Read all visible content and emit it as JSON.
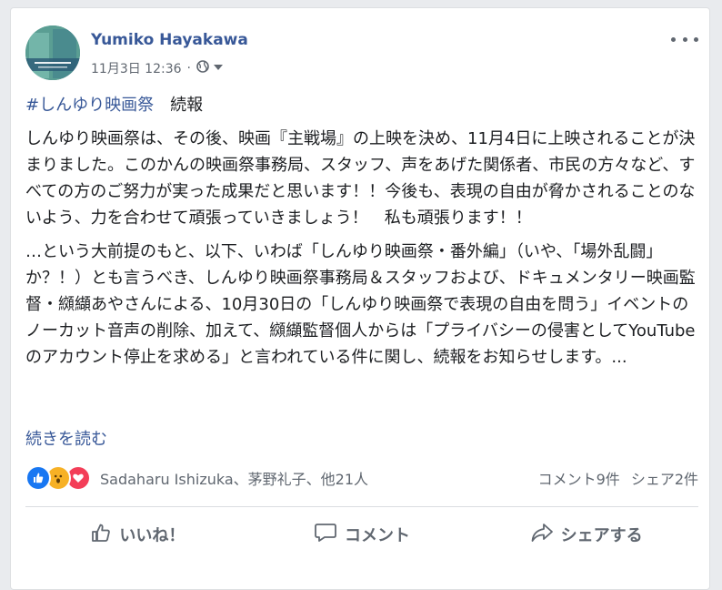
{
  "post": {
    "author": "Yumiko Hayakawa",
    "timestamp": "11月3日 12:36",
    "meta_separator": "·",
    "privacy_icon": "globe-icon",
    "options_icon": "more-options-icon",
    "hashtag": "#しんゆり映画祭",
    "heading_rest": "　続報",
    "paragraph1": "しんゆり映画祭は、その後、映画『主戦場』の上映を決め、11月4日に上映されることが決まりました。このかんの映画祭事務局、スタッフ、声をあげた関係者、市民の方々など、すべての方のご努力が実った成果だと思います！！今後も、表現の自由が脅かされることのないよう、力を合わせて頑張っていきましょう！　私も頑張ります！！",
    "paragraph2": "…という大前提のもと、以下、いわば「しんゆり映画祭・番外編」（いや、「場外乱闘」か？！）とも言うべき、しんゆり映画祭事務局＆スタッフおよび、ドキュメンタリー映画監督・纐纈あやさんによる、10月30日の「しんゆり映画祭で表現の自由を問う」イベントのノーカット音声の削除、加えて、纐纈監督個人からは「プライバシーの侵害としてYouTubeのアカウント停止を求める」と言われている件に関し、続報をお知らせします。...",
    "read_more": "続きを読む"
  },
  "reactions": {
    "icons": [
      "like-reaction-icon",
      "wow-reaction-icon",
      "love-reaction-icon"
    ],
    "names": "Sadaharu Ishizuka、茅野礼子、他21人",
    "comments": "コメント9件",
    "shares": "シェア2件"
  },
  "actions": {
    "like": "いいね！",
    "comment": "コメント",
    "share": "シェアする"
  },
  "colors": {
    "link": "#385898",
    "like": "#1877f2",
    "wow": "#f7b125",
    "love": "#f33e58",
    "muted": "#606770"
  }
}
